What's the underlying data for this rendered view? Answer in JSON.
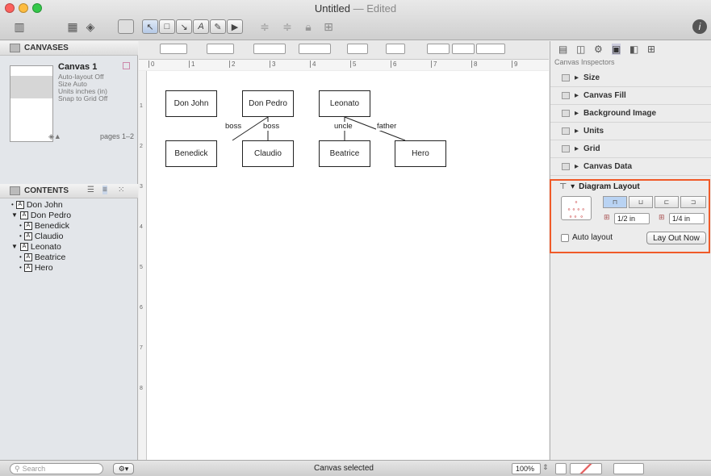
{
  "window": {
    "title": "Untitled",
    "title_suffix": "— Edited"
  },
  "sidebar": {
    "canvases_label": "CANVASES",
    "canvas": {
      "name": "Canvas 1",
      "meta": [
        "Auto-layout Off",
        "Size Auto",
        "Units inches (in)",
        "Snap to Grid Off"
      ],
      "pages": "pages 1–2"
    },
    "contents_label": "CONTENTS",
    "tree": [
      {
        "label": "Don John",
        "level": 0,
        "marker": "•"
      },
      {
        "label": "Don Pedro",
        "level": 0,
        "marker": "▼"
      },
      {
        "label": "Benedick",
        "level": 1,
        "marker": "•"
      },
      {
        "label": "Claudio",
        "level": 1,
        "marker": "•"
      },
      {
        "label": "Leonato",
        "level": 0,
        "marker": "▼"
      },
      {
        "label": "Beatrice",
        "level": 1,
        "marker": "•"
      },
      {
        "label": "Hero",
        "level": 1,
        "marker": "•"
      }
    ],
    "search_placeholder": "Search"
  },
  "ruler": {
    "ticks": [
      "0",
      "1",
      "2",
      "3",
      "4",
      "5",
      "6",
      "7",
      "8",
      "9"
    ],
    "vticks": [
      "1",
      "2",
      "3",
      "4",
      "5",
      "6",
      "7",
      "8"
    ]
  },
  "diagram": {
    "nodes": [
      "Don John",
      "Don Pedro",
      "Leonato",
      "Benedick",
      "Claudio",
      "Beatrice",
      "Hero"
    ],
    "edge_labels": [
      "boss",
      "boss",
      "uncle",
      "father"
    ]
  },
  "inspector": {
    "header": "Canvas Inspectors",
    "sections": [
      "Size",
      "Canvas Fill",
      "Background Image",
      "Units",
      "Grid",
      "Canvas Data"
    ],
    "layout": {
      "title": "Diagram Layout",
      "rank_sep": "1/2 in",
      "object_sep": "1/4 in",
      "auto_layout_label": "Auto layout",
      "lay_out_button": "Lay Out Now"
    }
  },
  "status": {
    "text": "Canvas selected",
    "zoom": "100%"
  },
  "colors": {
    "highlight": "#f05a28",
    "selected_segment": "#b9d3f3"
  }
}
